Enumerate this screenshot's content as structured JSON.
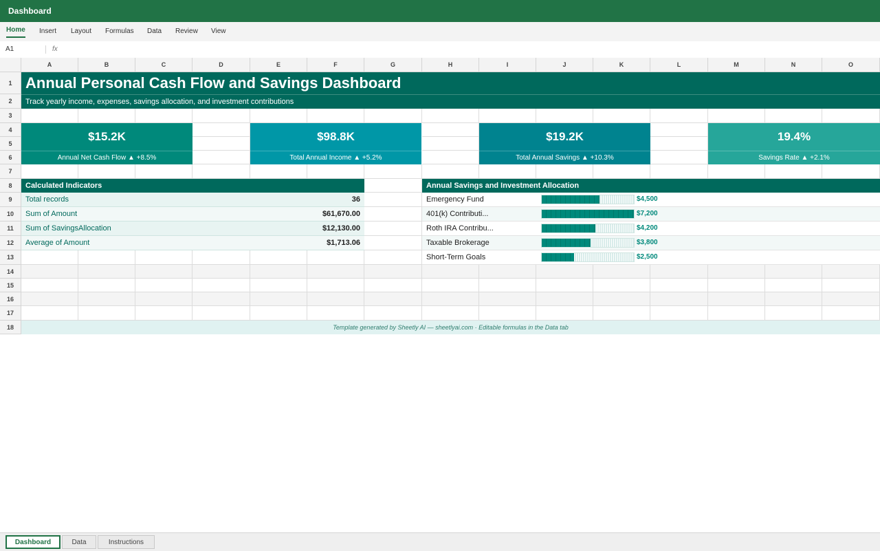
{
  "app": {
    "title": "Dashboard"
  },
  "ribbon": {
    "tabs": [
      "Home",
      "Insert",
      "Layout",
      "Formulas",
      "Data",
      "Review",
      "View"
    ],
    "active": "Home"
  },
  "formula_bar": {
    "cell_ref": "A1",
    "fx_label": "fx",
    "value": ""
  },
  "columns": [
    "A",
    "B",
    "C",
    "D",
    "E",
    "F",
    "G",
    "H",
    "I",
    "J",
    "K",
    "L",
    "M",
    "N",
    "O"
  ],
  "rows": [
    "1",
    "2",
    "3",
    "4",
    "5",
    "6",
    "7",
    "8",
    "9",
    "10",
    "11",
    "12",
    "13",
    "14",
    "15",
    "16",
    "17",
    "18"
  ],
  "dashboard": {
    "title": "Annual Personal Cash Flow and Savings Dashboard",
    "subtitle": "Track yearly income, expenses, savings allocation, and investment contributions",
    "kpis": [
      {
        "value": "$15.2K",
        "label": "Annual Net Cash Flow ▲ +8.5%",
        "color": "#00897b"
      },
      {
        "value": "$98.8K",
        "label": "Total Annual Income ▲ +5.2%",
        "color": "#0097a7"
      },
      {
        "value": "$19.2K",
        "label": "Total Annual Savings ▲ +10.3%",
        "color": "#00838f"
      },
      {
        "value": "19.4%",
        "label": "Savings Rate ▲ +2.1%",
        "color": "#26a69a"
      }
    ],
    "indicators": {
      "header": "Calculated Indicators",
      "rows": [
        {
          "label": "Total records",
          "value": "36"
        },
        {
          "label": "Sum of Amount",
          "value": "$61,670.00"
        },
        {
          "label": "Sum of SavingsAllocation",
          "value": "$12,130.00"
        },
        {
          "label": "Average of Amount",
          "value": "$1,713.06"
        }
      ]
    },
    "allocation": {
      "header": "Annual Savings and Investment Allocation",
      "max": 7200,
      "items": [
        {
          "label": "Emergency Fund",
          "value": 4500,
          "display": "$4,500"
        },
        {
          "label": "401(k) Contributi...",
          "value": 7200,
          "display": "$7,200"
        },
        {
          "label": "Roth IRA Contribu...",
          "value": 4200,
          "display": "$4,200"
        },
        {
          "label": "Taxable Brokerage",
          "value": 3800,
          "display": "$3,800"
        },
        {
          "label": "Short-Term Goals",
          "value": 2500,
          "display": "$2,500"
        }
      ]
    },
    "footer": "Template generated by Sheetly AI — sheetlyai.com · Editable formulas in the Data tab"
  },
  "sheet_tabs": {
    "tabs": [
      "Dashboard",
      "Data",
      "Instructions"
    ],
    "active": "Dashboard"
  },
  "colors": {
    "brand": "#217346",
    "banner": "#00695c",
    "bar": "#00897b"
  }
}
